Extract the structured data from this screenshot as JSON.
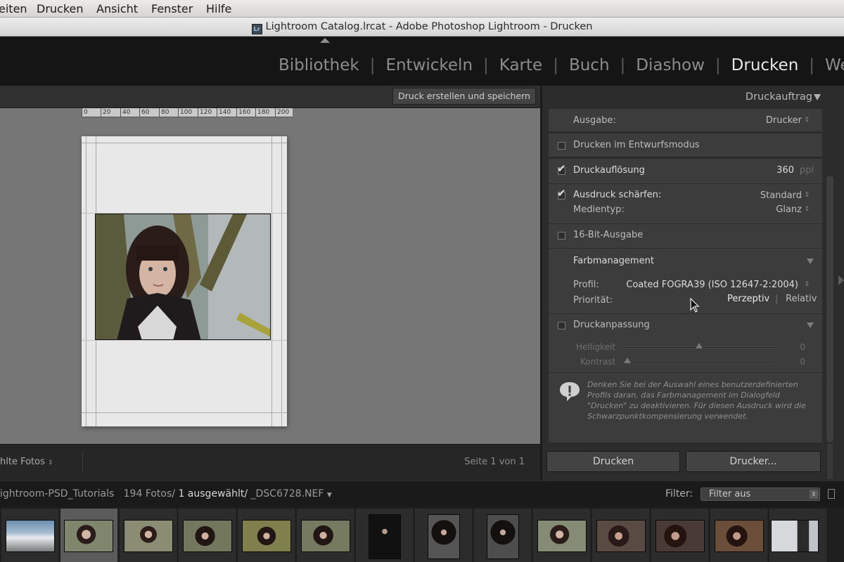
{
  "menu": {
    "items": [
      "eiten",
      "Drucken",
      "Ansicht",
      "Fenster",
      "Hilfe"
    ]
  },
  "window": {
    "title": "Lightroom Catalog.lrcat - Adobe Photoshop Lightroom - Drucken",
    "app_icon": "Lr"
  },
  "modules": {
    "items": [
      "Bibliothek",
      "Entwickeln",
      "Karte",
      "Buch",
      "Diashow",
      "Drucken",
      "Web"
    ],
    "active": "Drucken"
  },
  "toolbar": {
    "save_label": "Druck erstellen und speichern"
  },
  "ruler": {
    "ticks": [
      "0",
      "20",
      "40",
      "60",
      "80",
      "100",
      "120",
      "140",
      "160",
      "180",
      "200"
    ]
  },
  "bottom": {
    "left_label": "hlte Fotos",
    "page_info": "Seite 1 von 1"
  },
  "panel": {
    "title": "Druckauftrag",
    "ausgabe": {
      "label": "Ausgabe:",
      "value": "Drucker"
    },
    "draft": {
      "label": "Drucken im Entwurfsmodus",
      "checked": false
    },
    "resolution": {
      "label": "Druckauflösung",
      "value": "360",
      "unit": "ppi",
      "checked": true
    },
    "sharpen": {
      "label": "Ausdruck schärfen:",
      "value": "Standard",
      "media_label": "Medientyp:",
      "media_value": "Glanz",
      "checked": true
    },
    "bit16": {
      "label": "16-Bit-Ausgabe",
      "checked": false
    },
    "color": {
      "header": "Farbmanagement",
      "profile_label": "Profil:",
      "profile_value": "Coated FOGRA39 (ISO 12647-2:2004)",
      "intent_label": "Priorität:",
      "intent_options": [
        "Perzeptiv",
        "Relativ"
      ],
      "intent_selected": "Perzeptiv"
    },
    "adjust": {
      "label": "Druckanpassung",
      "checked": false,
      "brightness_label": "Helligkeit",
      "brightness_value": "0",
      "contrast_label": "Kontrast",
      "contrast_value": "0"
    },
    "note": "Denken Sie bei der Auswahl eines benutzerdefinierten Profils daran, das Farbmanagement im Dialogfeld \"Drucken\" zu deaktivieren. Für diesen Ausdruck wird die Schwarzpunktkompensierung verwendet."
  },
  "print_buttons": {
    "print": "Drucken",
    "printer": "Drucker..."
  },
  "filmstrip": {
    "source": "ightroom-PSD_Tutorials",
    "count": "194 Fotos/",
    "selected": "1 ausgewählt/",
    "file": "_DSC6728.NEF",
    "filter_label": "Filter:",
    "filter_value": "Filter aus"
  }
}
